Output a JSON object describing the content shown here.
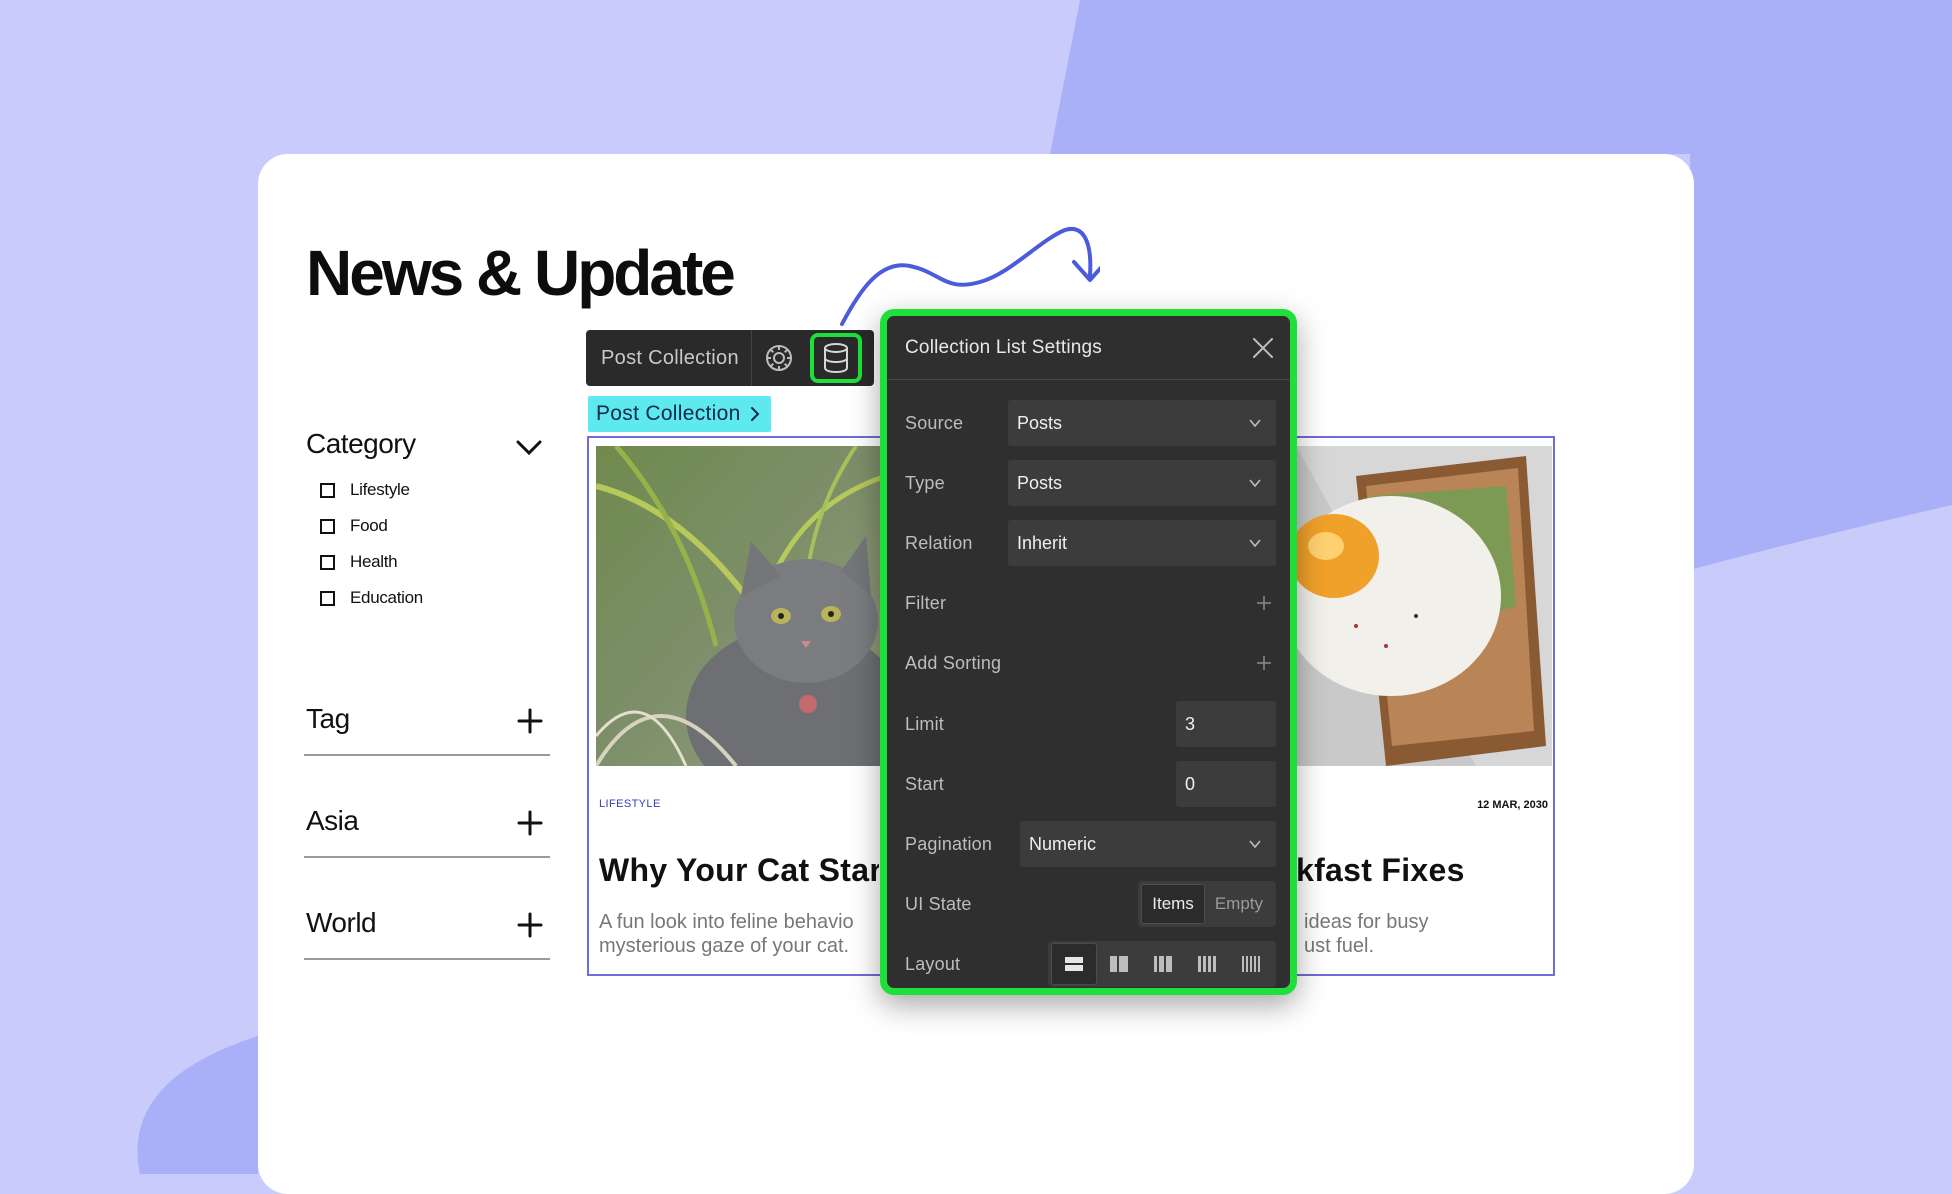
{
  "page": {
    "title": "News & Update"
  },
  "sidebar": {
    "category": {
      "heading": "Category",
      "items": [
        "Lifestyle",
        "Food",
        "Health",
        "Education"
      ]
    },
    "sections": [
      "Tag",
      "Asia",
      "World"
    ]
  },
  "toolbar": {
    "label": "Post Collection",
    "settings_icon": "gear-icon",
    "database_icon": "database-icon"
  },
  "breadcrumb": {
    "label": "Post Collection"
  },
  "posts": [
    {
      "category": "LIFESTYLE",
      "title": "Why Your Cat Star",
      "desc_line1": "A fun look into feline behavio",
      "desc_line2": "mysterious gaze of your cat."
    },
    {
      "date": "12 MAR, 2030",
      "title": "kfast Fixes",
      "desc_line1": "ideas for busy",
      "desc_line2": "ust fuel."
    }
  ],
  "settings": {
    "title": "Collection List Settings",
    "source": {
      "label": "Source",
      "value": "Posts"
    },
    "type": {
      "label": "Type",
      "value": "Posts"
    },
    "relation": {
      "label": "Relation",
      "value": "Inherit"
    },
    "filter": {
      "label": "Filter"
    },
    "sorting": {
      "label": "Add Sorting"
    },
    "limit": {
      "label": "Limit",
      "value": "3"
    },
    "start": {
      "label": "Start",
      "value": "0"
    },
    "pagination": {
      "label": "Pagination",
      "value": "Numeric"
    },
    "ui_state": {
      "label": "UI State",
      "options": [
        "Items",
        "Empty"
      ],
      "selected": "Items"
    },
    "layout": {
      "label": "Layout",
      "options": [
        "layout-1-column",
        "layout-2-column",
        "layout-3-column",
        "layout-4-column",
        "layout-5-column"
      ],
      "selected_index": 0
    }
  },
  "colors": {
    "accent_green": "#1fe03b",
    "breadcrumb_cyan": "#5ee9ef",
    "frame_purple": "#6f6bd8",
    "arrow_blue": "#4a5bdc"
  }
}
